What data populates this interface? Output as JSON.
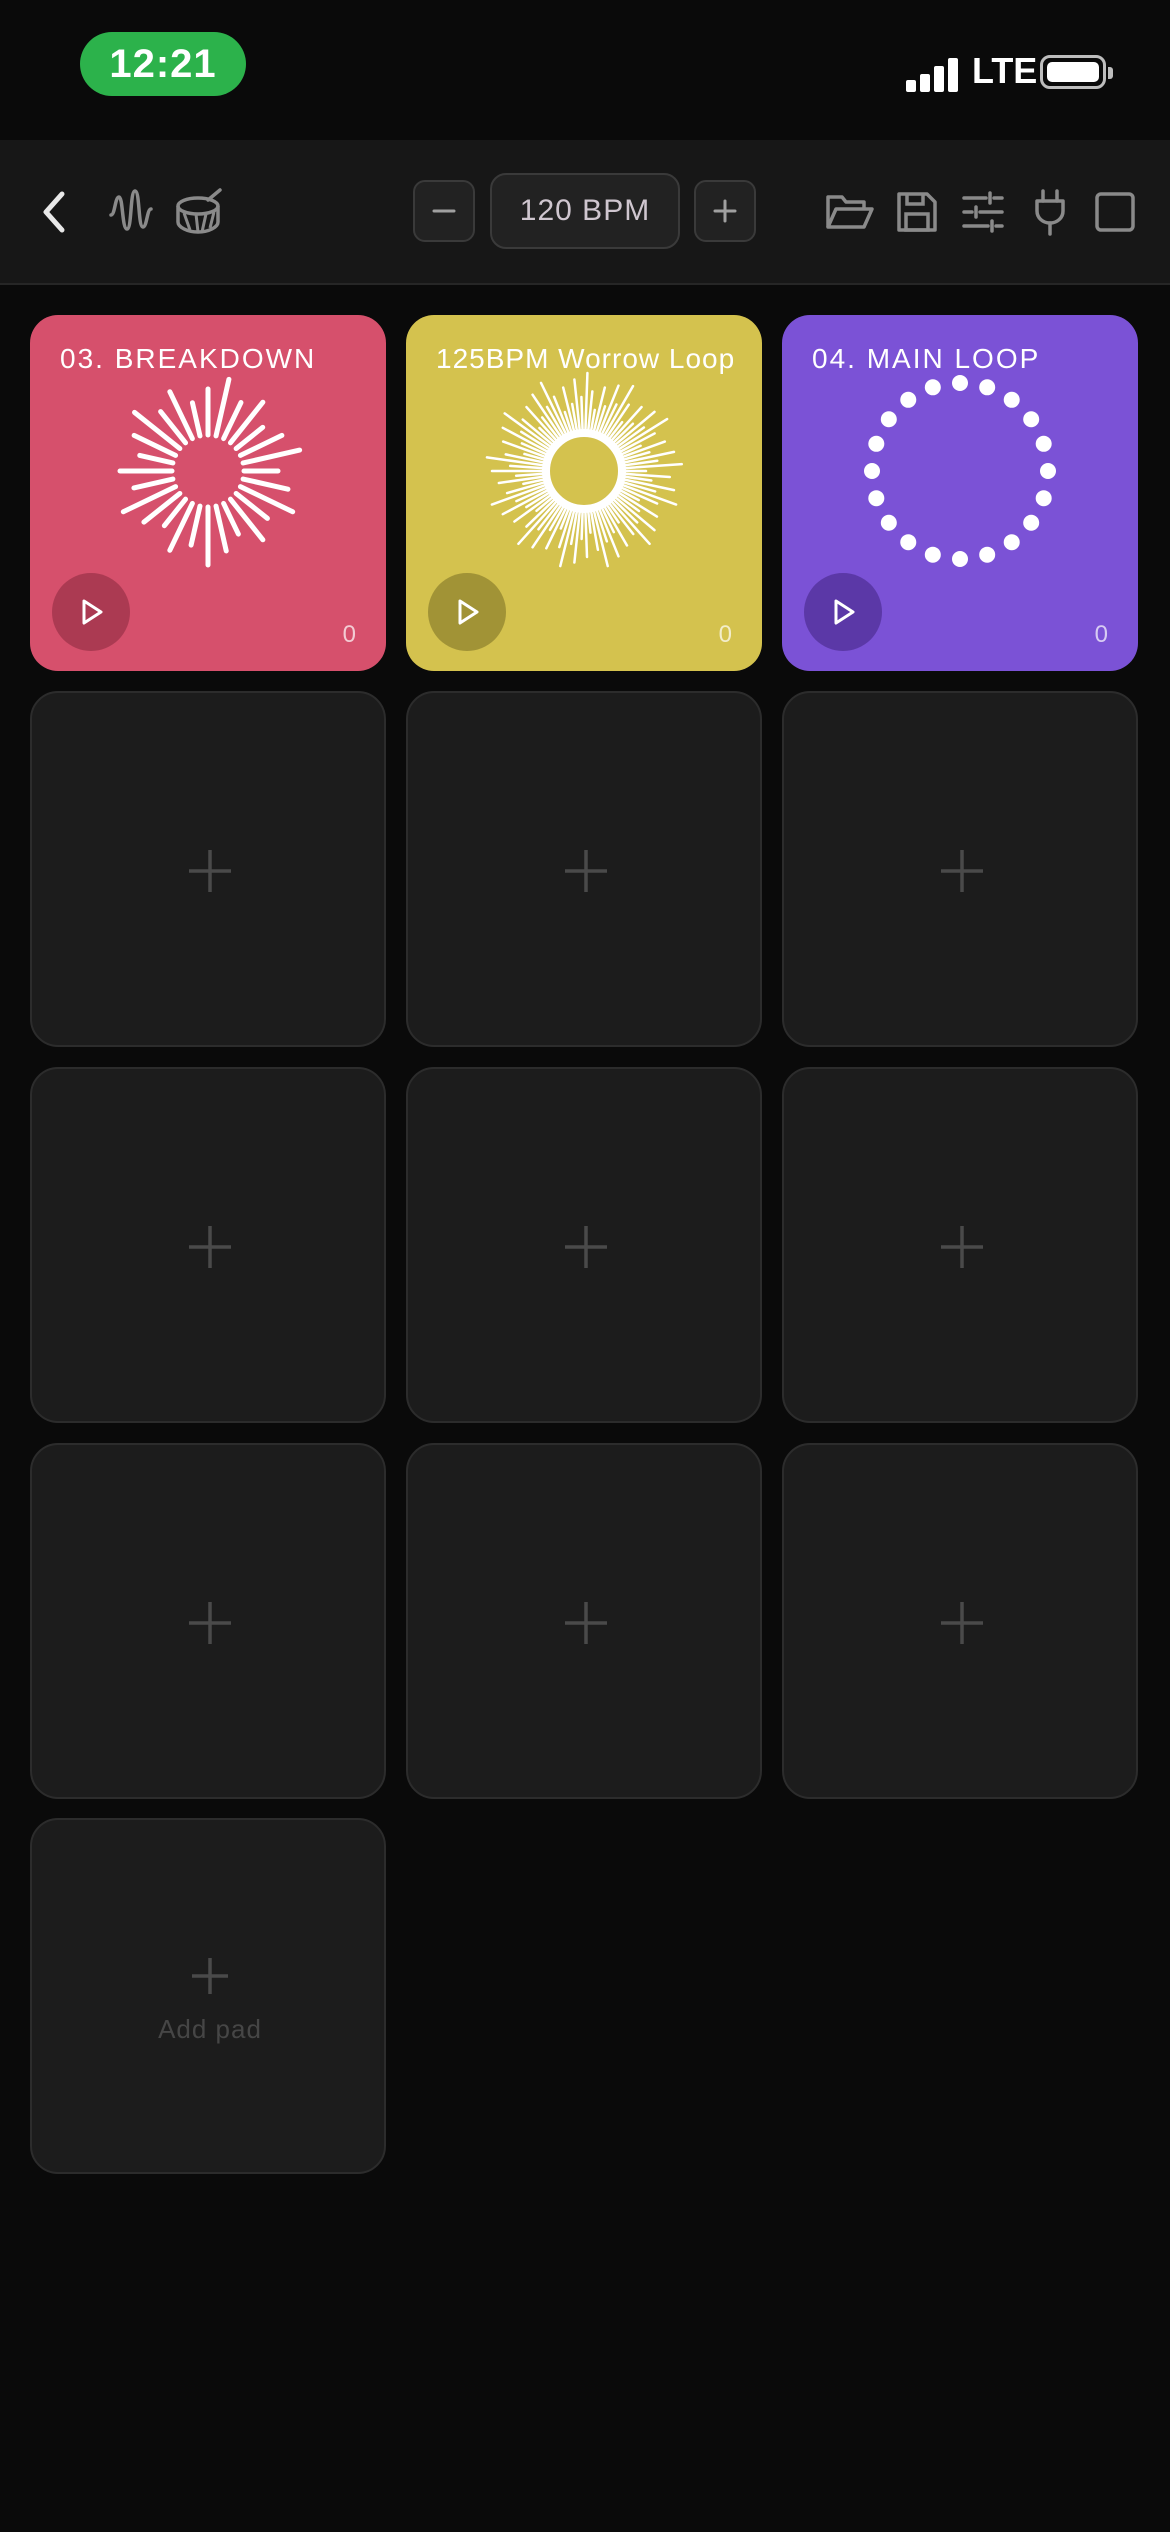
{
  "status_bar": {
    "time": "12:21",
    "network": "LTE",
    "signal_icon": "signal-bars-icon",
    "battery_icon": "battery-icon",
    "accent_color": "#2cb24b"
  },
  "toolbar": {
    "back_icon": "chevron-left-icon",
    "waveform_icon": "waveform-icon",
    "drum_icon": "drum-icon",
    "bpm_minus_icon": "minus-icon",
    "bpm_value": "120 BPM",
    "bpm_plus_icon": "plus-icon",
    "open_icon": "folder-open-icon",
    "save_icon": "floppy-disk-icon",
    "mixer_icon": "sliders-icon",
    "plugin_icon": "plug-icon",
    "stop_icon": "square-stop-icon"
  },
  "pads": [
    {
      "title": "03. BREAKDOWN",
      "count": "0",
      "color": "#d6506c",
      "viz": "radial-lines",
      "play_icon": "play-icon"
    },
    {
      "title": "125BPM Worrow Loop",
      "count": "0",
      "color": "#d4c24e",
      "viz": "dense-sunburst",
      "play_icon": "play-icon"
    },
    {
      "title": "04. MAIN LOOP",
      "count": "0",
      "color": "#7b52d6",
      "viz": "dot-ring",
      "play_icon": "play-icon"
    }
  ],
  "empty_pad_icon": "plus-icon",
  "add_pad": {
    "label": "Add pad",
    "icon": "plus-icon"
  }
}
